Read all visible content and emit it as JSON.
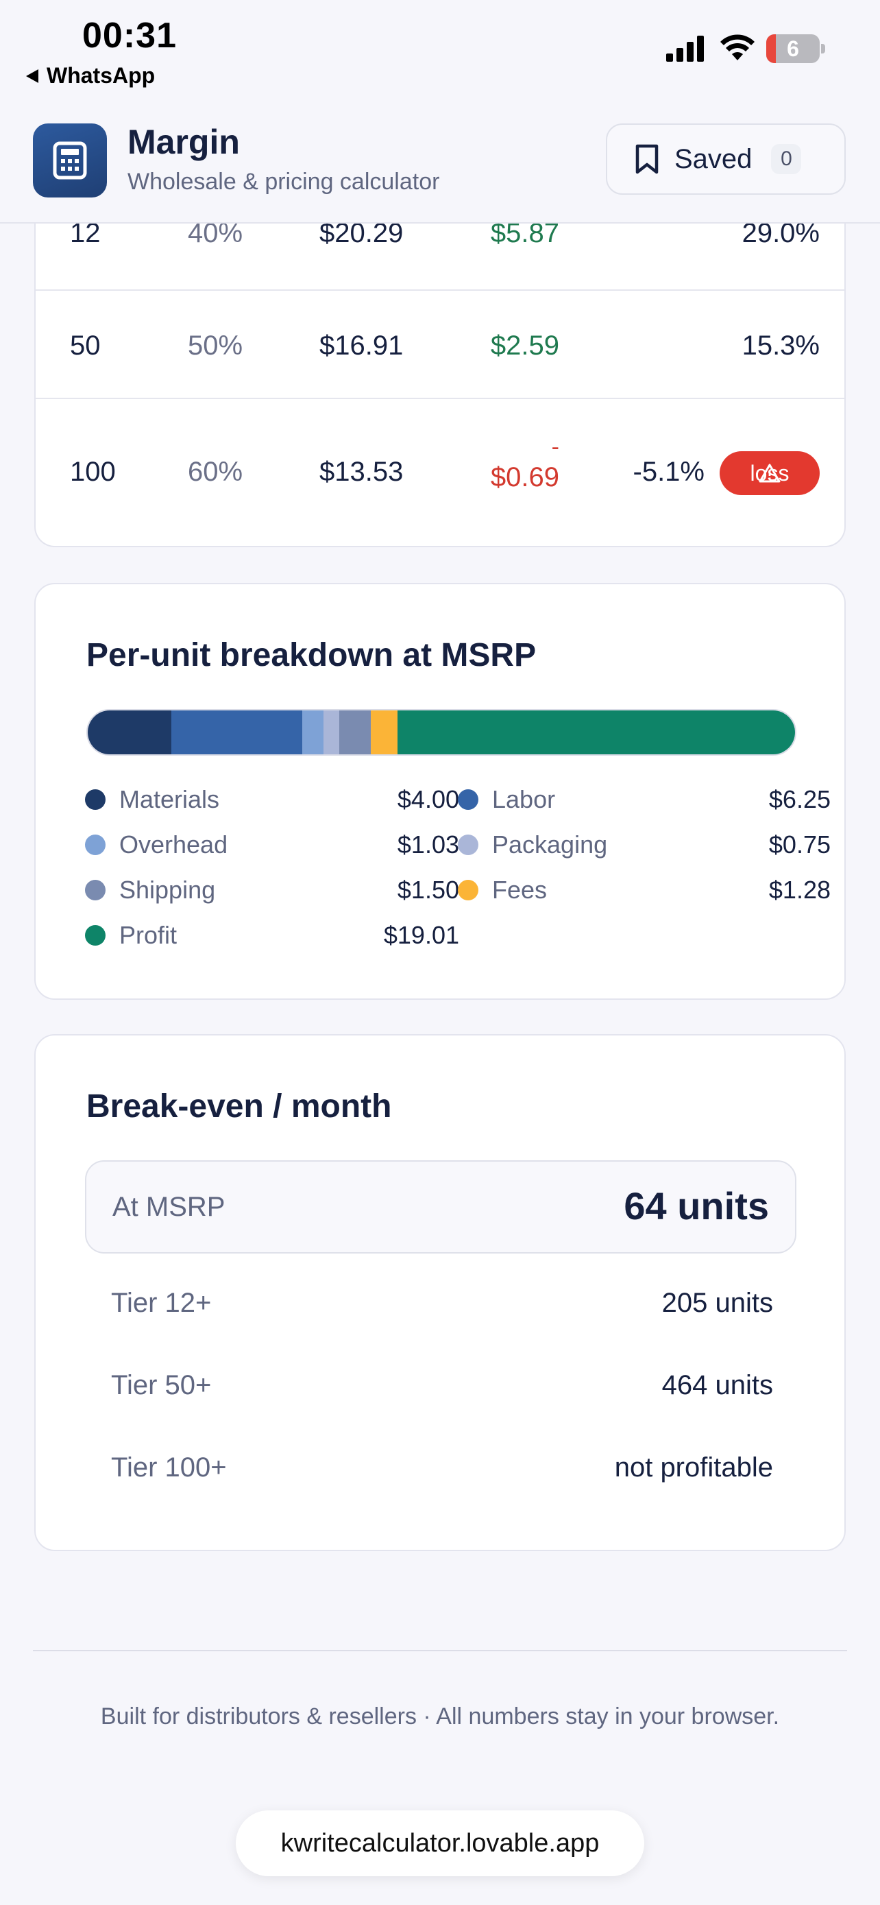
{
  "status_bar": {
    "time": "00:31",
    "back_app": "WhatsApp",
    "battery_level": "6",
    "icons": [
      "signal-icon",
      "wifi-icon",
      "battery-icon"
    ]
  },
  "header": {
    "title": "Margin",
    "subtitle": "Wholesale & pricing calculator",
    "saved_label": "Saved",
    "saved_count": "0",
    "logo_icon": "calculator-icon"
  },
  "tiers_table": {
    "rows": [
      {
        "qty": "12",
        "discount": "40%",
        "price": "$20.29",
        "profit": "$5.87",
        "margin": "29.0%"
      },
      {
        "qty": "50",
        "discount": "50%",
        "price": "$16.91",
        "profit": "$2.59",
        "margin": "15.3%"
      },
      {
        "qty": "100",
        "discount": "60%",
        "price": "$13.53",
        "profit_sign": "-",
        "profit": "$0.69",
        "margin": "-5.1%",
        "badge": "loss"
      }
    ]
  },
  "breakdown": {
    "title": "Per-unit breakdown at MSRP",
    "items": [
      {
        "name": "Materials",
        "value": "$4.00",
        "amount": 4.0,
        "color": "#1e3a67"
      },
      {
        "name": "Labor",
        "value": "$6.25",
        "amount": 6.25,
        "color": "#3564a8"
      },
      {
        "name": "Overhead",
        "value": "$1.03",
        "amount": 1.03,
        "color": "#7ea2d6"
      },
      {
        "name": "Packaging",
        "value": "$0.75",
        "amount": 0.75,
        "color": "#aab6d8"
      },
      {
        "name": "Shipping",
        "value": "$1.50",
        "amount": 1.5,
        "color": "#7a8bb0"
      },
      {
        "name": "Fees",
        "value": "$1.28",
        "amount": 1.28,
        "color": "#fbb437"
      },
      {
        "name": "Profit",
        "value": "$19.01",
        "amount": 19.01,
        "color": "#0e8468"
      }
    ]
  },
  "break_even": {
    "title": "Break-even / month",
    "msrp_label": "At MSRP",
    "msrp_value": "64 units",
    "tiers": [
      {
        "label": "Tier 12+",
        "value": "205 units"
      },
      {
        "label": "Tier 50+",
        "value": "464 units"
      },
      {
        "label": "Tier 100+",
        "value": "not profitable"
      }
    ]
  },
  "footer": {
    "text": "Built for distributors & resellers · All numbers stay in your browser.",
    "url": "kwritecalculator.lovable.app"
  }
}
